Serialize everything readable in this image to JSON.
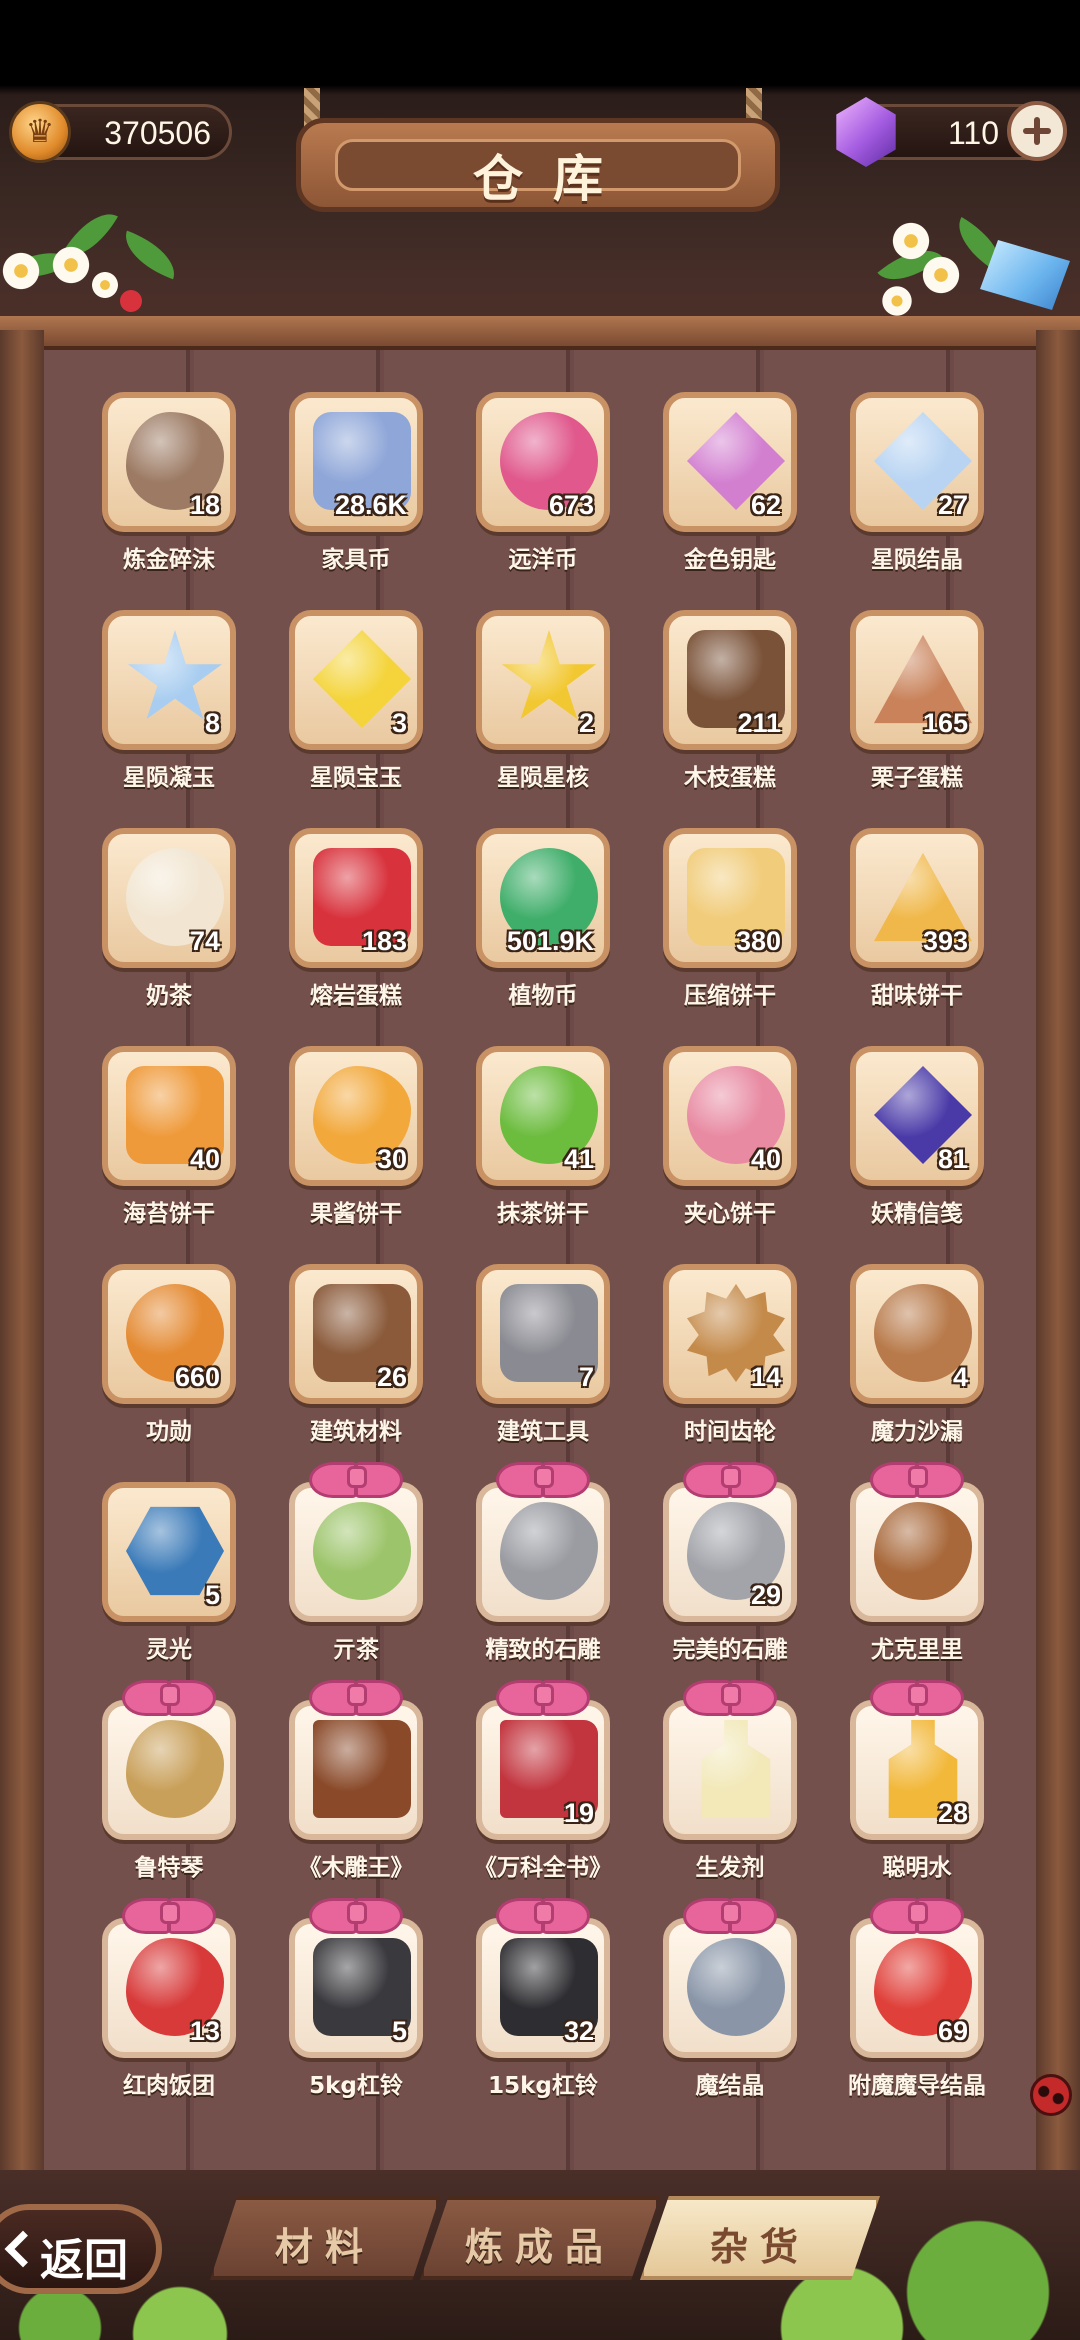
{
  "header": {
    "title": "仓库",
    "coins": "370506",
    "gems": "110"
  },
  "icons": {
    "coin": "crown-coin-icon",
    "gem": "purple-gem-icon",
    "add": "plus-icon",
    "back": "chevron-left-icon"
  },
  "colors": {
    "board": "#74504c",
    "slot_bg": "#fbe9cf",
    "slot_border": "#c99264",
    "gift_bow": "#e7659a",
    "active_tab": "#f7e8c9"
  },
  "items": [
    {
      "name": "炼金碎沫",
      "count": "18",
      "icon": "alchemy-fragments-icon",
      "color": "#9c7a63",
      "shape": "s-blob"
    },
    {
      "name": "家具币",
      "count": "28.6K",
      "icon": "furniture-coin-icon",
      "color": "#8ea6d8",
      "shape": "s-round"
    },
    {
      "name": "远洋币",
      "count": "673",
      "icon": "ocean-coin-icon",
      "color": "#e0588c",
      "shape": "s-circle"
    },
    {
      "name": "金色钥匙",
      "count": "62",
      "icon": "golden-key-icon",
      "color": "#d27fd0",
      "shape": "s-diamond"
    },
    {
      "name": "星陨结晶",
      "count": "27",
      "icon": "star-crystal-icon",
      "color": "#b8d4f2",
      "shape": "s-diamond"
    },
    {
      "name": "星陨凝玉",
      "count": "8",
      "icon": "star-jade-icon",
      "color": "#a8cdf0",
      "shape": "s-star"
    },
    {
      "name": "星陨宝玉",
      "count": "3",
      "icon": "star-gem-icon",
      "color": "#f4d43a",
      "shape": "s-diamond"
    },
    {
      "name": "星陨星核",
      "count": "2",
      "icon": "star-core-icon",
      "color": "#f2c832",
      "shape": "s-star"
    },
    {
      "name": "木枝蛋糕",
      "count": "211",
      "icon": "log-cake-icon",
      "color": "#7a5238",
      "shape": "s-round"
    },
    {
      "name": "栗子蛋糕",
      "count": "165",
      "icon": "chestnut-cake-icon",
      "color": "#c9825a",
      "shape": "s-tri"
    },
    {
      "name": "奶茶",
      "count": "74",
      "icon": "milk-tea-icon",
      "color": "#f2e6d2",
      "shape": "s-circle"
    },
    {
      "name": "熔岩蛋糕",
      "count": "183",
      "icon": "lava-cake-icon",
      "color": "#d8323c",
      "shape": "s-round"
    },
    {
      "name": "植物币",
      "count": "501.9K",
      "icon": "plant-coin-icon",
      "color": "#3fae6a",
      "shape": "s-circle"
    },
    {
      "name": "压缩饼干",
      "count": "380",
      "icon": "compressed-biscuit-icon",
      "color": "#f1cc7a",
      "shape": "s-round"
    },
    {
      "name": "甜味饼干",
      "count": "393",
      "icon": "sweet-biscuit-icon",
      "color": "#f0b84a",
      "shape": "s-tri"
    },
    {
      "name": "海苔饼干",
      "count": "40",
      "icon": "seaweed-biscuit-icon",
      "color": "#ef9a3a",
      "shape": "s-round"
    },
    {
      "name": "果酱饼干",
      "count": "30",
      "icon": "jam-biscuit-icon",
      "color": "#f2a83a",
      "shape": "s-blob"
    },
    {
      "name": "抹茶饼干",
      "count": "41",
      "icon": "matcha-biscuit-icon",
      "color": "#6cbc3e",
      "shape": "s-blob"
    },
    {
      "name": "夹心饼干",
      "count": "40",
      "icon": "sandwich-biscuit-icon",
      "color": "#e88aa2",
      "shape": "s-circle"
    },
    {
      "name": "妖精信笺",
      "count": "81",
      "icon": "fairy-letter-icon",
      "color": "#4a3aa8",
      "shape": "s-diamond"
    },
    {
      "name": "功勋",
      "count": "660",
      "icon": "medal-icon",
      "color": "#e48a32",
      "shape": "s-circle"
    },
    {
      "name": "建筑材料",
      "count": "26",
      "icon": "building-materials-icon",
      "color": "#8a5a3a",
      "shape": "s-round"
    },
    {
      "name": "建筑工具",
      "count": "7",
      "icon": "hammer-icon",
      "color": "#8a8a92",
      "shape": "s-round"
    },
    {
      "name": "时间齿轮",
      "count": "14",
      "icon": "gear-icon",
      "color": "#c48a4a",
      "shape": "s-gear"
    },
    {
      "name": "魔力沙漏",
      "count": "4",
      "icon": "hourglass-icon",
      "color": "#b87a4a",
      "shape": "s-circle"
    },
    {
      "name": "灵光",
      "count": "5",
      "icon": "spirit-light-icon",
      "color": "#3a7ab8",
      "shape": "s-hex"
    },
    {
      "name": "亓茶",
      "count": "",
      "icon": "tea-bowl-icon",
      "color": "#9cc46a",
      "shape": "s-circle",
      "gift": true
    },
    {
      "name": "精致的石雕",
      "count": "",
      "icon": "stone-bird-statue-icon",
      "color": "#9a9ca2",
      "shape": "s-blob",
      "gift": true
    },
    {
      "name": "完美的石雕",
      "count": "29",
      "icon": "stone-figure-statue-icon",
      "color": "#a2a4aa",
      "shape": "s-blob",
      "gift": true
    },
    {
      "name": "尤克里里",
      "count": "",
      "icon": "ukulele-icon",
      "color": "#a8683a",
      "shape": "s-blob",
      "gift": true
    },
    {
      "name": "鲁特琴",
      "count": "",
      "icon": "lute-icon",
      "color": "#c9a05a",
      "shape": "s-blob",
      "gift": true
    },
    {
      "name": "《木雕王》",
      "count": "",
      "icon": "brown-book-icon",
      "color": "#8a4a2a",
      "shape": "s-book",
      "gift": true
    },
    {
      "name": "《万科全书》",
      "count": "19",
      "icon": "red-book-icon",
      "color": "#c2343e",
      "shape": "s-book",
      "gift": true
    },
    {
      "name": "生发剂",
      "count": "",
      "icon": "potion-bottle-icon",
      "color": "#f2e8b8",
      "shape": "s-bottle",
      "gift": true
    },
    {
      "name": "聪明水",
      "count": "28",
      "icon": "smart-potion-icon",
      "color": "#f2b83a",
      "shape": "s-bottle",
      "gift": true
    },
    {
      "name": "红肉饭团",
      "count": "13",
      "icon": "rice-ball-icon",
      "color": "#d83a3a",
      "shape": "s-blob",
      "gift": true
    },
    {
      "name": "5kg杠铃",
      "count": "5",
      "icon": "dumbbell-icon",
      "color": "#3a3a3e",
      "shape": "s-round",
      "gift": true
    },
    {
      "name": "15kg杠铃",
      "count": "32",
      "icon": "heavy-dumbbell-icon",
      "color": "#2e2e32",
      "shape": "s-round",
      "gift": true
    },
    {
      "name": "魔结晶",
      "count": "",
      "icon": "magic-crystal-icon",
      "color": "#8a96a8",
      "shape": "s-circle",
      "gift": true
    },
    {
      "name": "附魔魔导结晶",
      "count": "69",
      "icon": "enchanted-crystal-icon",
      "color": "#e0403a",
      "shape": "s-blob",
      "gift": true
    }
  ],
  "tabs": [
    {
      "label": "材料",
      "active": false
    },
    {
      "label": "炼成品",
      "active": false
    },
    {
      "label": "杂货",
      "active": true
    }
  ],
  "back_label": "返回"
}
